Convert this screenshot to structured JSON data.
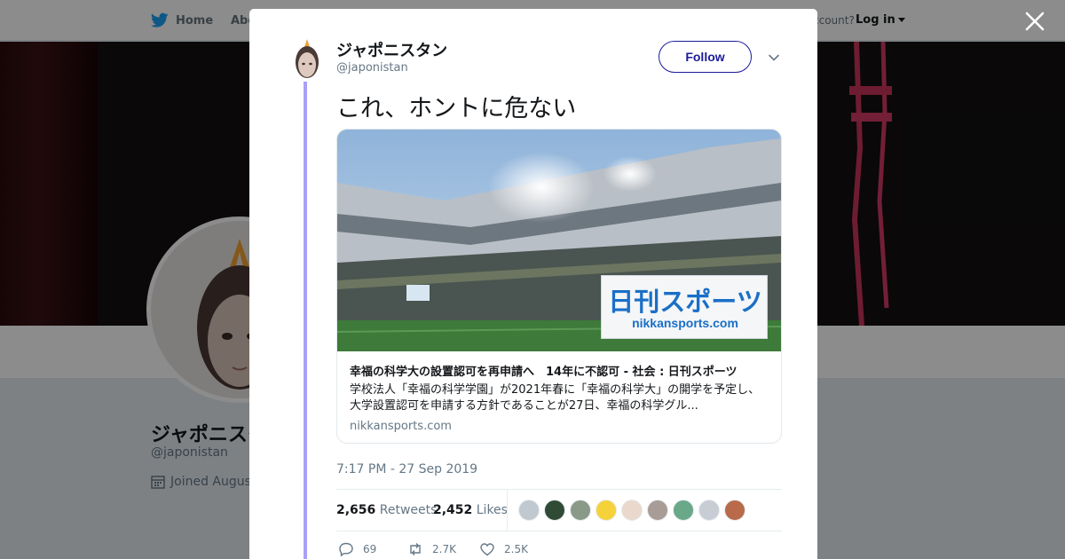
{
  "nav": {
    "home_label": "Home",
    "about_label": "Abo",
    "account_text": "ccount?",
    "login_label": "Log in"
  },
  "profile": {
    "name": "ジャポニスタ",
    "handle": "@japonistan",
    "joined_text": "Joined August"
  },
  "tweet": {
    "author_name": "ジャポニスタン",
    "author_handle": "@japonistan",
    "follow_label": "Follow",
    "text": "これ、ホントに危ない",
    "timestamp": "7:17 PM - 27 Sep 2019",
    "card": {
      "title": "幸福の科学大の設置認可を再申請へ　14年に不認可 - 社会 : 日刊スポーツ",
      "description": "学校法人「幸福の科学学園」が2021年春に「幸福の科学大」の開学を予定し、大学設置認可を申請する方針であることが27日、幸福の科学グル...",
      "domain": "nikkansports.com",
      "logo_main": "日刊スポーツ",
      "logo_sub": "nikkansports.com"
    },
    "stats": {
      "retweets_count": "2,656",
      "retweets_label": "Retweets",
      "likes_count": "2,452",
      "likes_label": "Likes"
    },
    "actions": {
      "reply_count": "69",
      "retweet_count": "2.7K",
      "like_count": "2.5K"
    }
  },
  "colors": {
    "twitter_blue": "#1da1f2",
    "follow_accent": "#1b1b9a",
    "thread_line": "#a9a1f7",
    "logo_blue": "#1a6fc6"
  },
  "liker_avatars": [
    "default-avatar-icon",
    "dark-green-avatar-icon",
    "landscape-avatar-icon",
    "penguin-avatar-icon",
    "sketch-avatar-icon",
    "pattern-avatar-icon",
    "green-figure-avatar-icon",
    "gray-abstract-avatar-icon",
    "portrait-avatar-icon"
  ]
}
